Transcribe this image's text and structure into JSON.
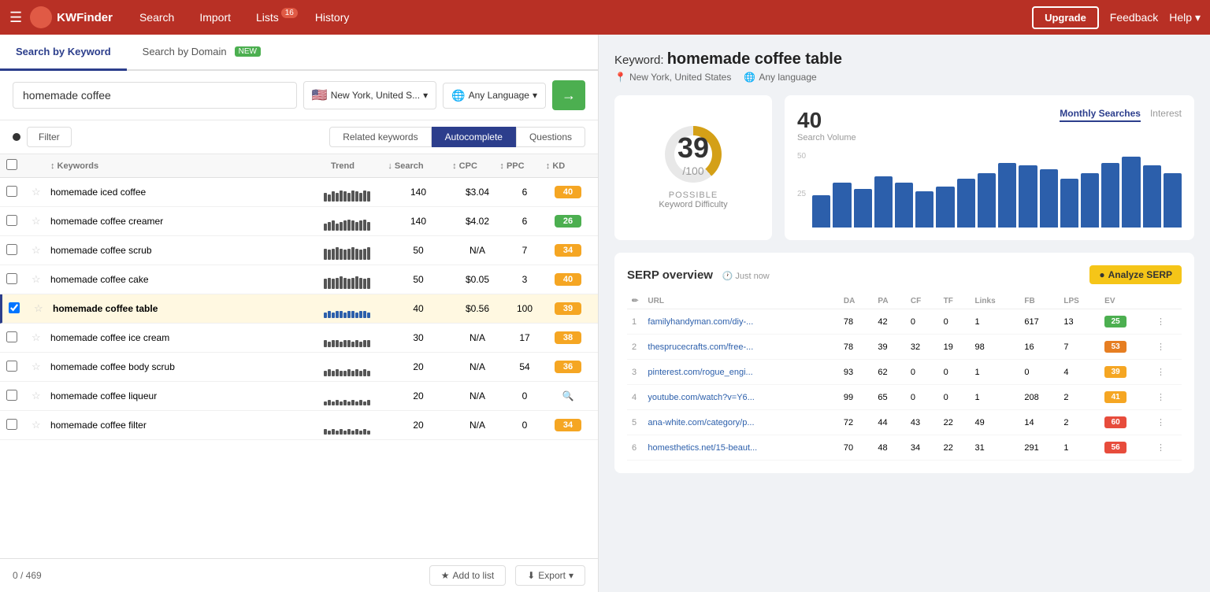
{
  "app": {
    "name": "KWFinder",
    "logo_color": "#b83025"
  },
  "nav": {
    "menu_icon": "☰",
    "links": [
      {
        "id": "search",
        "label": "Search",
        "active": false
      },
      {
        "id": "import",
        "label": "Import",
        "active": false
      },
      {
        "id": "lists",
        "label": "Lists",
        "active": false,
        "badge": "16"
      },
      {
        "id": "history",
        "label": "History",
        "active": false
      }
    ],
    "upgrade_label": "Upgrade",
    "feedback_label": "Feedback",
    "help_label": "Help ▾"
  },
  "left": {
    "tabs": [
      {
        "id": "by-keyword",
        "label": "Search by Keyword",
        "active": true
      },
      {
        "id": "by-domain",
        "label": "Search by Domain",
        "badge": "NEW",
        "active": false
      }
    ],
    "search_input": {
      "value": "homemade coffee",
      "placeholder": "Enter keyword"
    },
    "location": {
      "flag": "🇺🇸",
      "text": "New York, United S..."
    },
    "language": {
      "text": "Any Language"
    },
    "filter_label": "Filter",
    "keyword_type_tabs": [
      {
        "id": "related",
        "label": "Related keywords",
        "active": false
      },
      {
        "id": "autocomplete",
        "label": "Autocomplete",
        "active": true
      },
      {
        "id": "questions",
        "label": "Questions",
        "active": false
      }
    ],
    "table": {
      "columns": [
        "Keywords",
        "Trend",
        "Search",
        "CPC",
        "PPC",
        "KD"
      ],
      "rows": [
        {
          "keyword": "homemade iced coffee",
          "search": 140,
          "cpc": "$3.04",
          "ppc": 6,
          "kd": 40,
          "kd_color": "#f5a623",
          "selected": false,
          "highlighted": false,
          "trend_heights": [
            6,
            5,
            7,
            6,
            8,
            7,
            6,
            8,
            7,
            6,
            8,
            7
          ]
        },
        {
          "keyword": "homemade coffee creamer",
          "search": 140,
          "cpc": "$4.02",
          "ppc": 6,
          "kd": 26,
          "kd_color": "#4CAF50",
          "selected": false,
          "highlighted": false,
          "trend_heights": [
            5,
            6,
            7,
            5,
            6,
            7,
            8,
            7,
            6,
            7,
            8,
            6
          ]
        },
        {
          "keyword": "homemade coffee scrub",
          "search": 50,
          "cpc": "N/A",
          "ppc": 7,
          "kd": 34,
          "kd_color": "#f5a623",
          "selected": false,
          "highlighted": false,
          "trend_heights": [
            8,
            7,
            8,
            9,
            8,
            7,
            8,
            9,
            8,
            7,
            8,
            9
          ]
        },
        {
          "keyword": "homemade coffee cake",
          "search": 50,
          "cpc": "$0.05",
          "ppc": 3,
          "kd": 40,
          "kd_color": "#f5a623",
          "selected": false,
          "highlighted": false,
          "trend_heights": [
            7,
            8,
            7,
            8,
            9,
            8,
            7,
            8,
            9,
            8,
            7,
            8
          ]
        },
        {
          "keyword": "homemade coffee table",
          "search": 40,
          "cpc": "$0.56",
          "ppc": 100,
          "kd": 39,
          "kd_color": "#f5a623",
          "selected": true,
          "highlighted": true,
          "trend_heights": [
            4,
            5,
            4,
            5,
            5,
            4,
            5,
            5,
            4,
            5,
            5,
            4
          ]
        },
        {
          "keyword": "homemade coffee ice cream",
          "search": 30,
          "cpc": "N/A",
          "ppc": 17,
          "kd": 38,
          "kd_color": "#f5a623",
          "selected": false,
          "highlighted": false,
          "trend_heights": [
            5,
            4,
            5,
            5,
            4,
            5,
            5,
            4,
            5,
            4,
            5,
            5
          ]
        },
        {
          "keyword": "homemade coffee body scrub",
          "search": 20,
          "cpc": "N/A",
          "ppc": 54,
          "kd": 36,
          "kd_color": "#f5a623",
          "selected": false,
          "highlighted": false,
          "trend_heights": [
            4,
            5,
            4,
            5,
            4,
            4,
            5,
            4,
            5,
            4,
            5,
            4
          ]
        },
        {
          "keyword": "homemade coffee liqueur",
          "search": 20,
          "cpc": "N/A",
          "ppc": 0,
          "kd": null,
          "kd_color": "#999",
          "selected": false,
          "highlighted": false,
          "trend_heights": [
            3,
            4,
            3,
            4,
            3,
            4,
            3,
            4,
            3,
            4,
            3,
            4
          ]
        },
        {
          "keyword": "homemade coffee filter",
          "search": 20,
          "cpc": "N/A",
          "ppc": 0,
          "kd": 34,
          "kd_color": "#f5a623",
          "selected": false,
          "highlighted": false,
          "trend_heights": [
            4,
            3,
            4,
            3,
            4,
            3,
            4,
            3,
            4,
            3,
            4,
            3
          ]
        }
      ]
    },
    "footer": {
      "count": "0 / 469",
      "add_to_list": "Add to list",
      "export": "Export"
    }
  },
  "right": {
    "keyword_label": "Keyword:",
    "keyword_name": "homemade coffee table",
    "location": "New York, United States",
    "language": "Any language",
    "kd": {
      "value": 39,
      "total": 100,
      "label": "POSSIBLE",
      "sublabel": "Keyword Difficulty"
    },
    "volume": {
      "value": 40,
      "label": "Search Volume",
      "tabs": [
        {
          "id": "monthly",
          "label": "Monthly Searches",
          "active": true
        },
        {
          "id": "interest",
          "label": "Interest",
          "active": false
        }
      ],
      "chart_bars": [
        25,
        35,
        30,
        40,
        35,
        28,
        32,
        38,
        42,
        50,
        48,
        45,
        38,
        42,
        50,
        55,
        48,
        42
      ]
    },
    "serp": {
      "title": "SERP overview",
      "meta": "Just now",
      "analyze_btn": "Analyze SERP",
      "columns": [
        "#",
        "URL",
        "DA",
        "PA",
        "CF",
        "TF",
        "Links",
        "FB",
        "LPS",
        "EV"
      ],
      "rows": [
        {
          "rank": 1,
          "url": "familyhandyman.com/diy-...",
          "da": 78,
          "pa": 42,
          "cf": 0,
          "tf": 0,
          "links": 1,
          "fb": 617,
          "lps": 13,
          "ev": 25,
          "ev_color": "#4CAF50"
        },
        {
          "rank": 2,
          "url": "thesprucecrafts.com/free-...",
          "da": 78,
          "pa": 39,
          "cf": 32,
          "tf": 19,
          "links": 98,
          "fb": 16,
          "lps": 7,
          "ev": 53,
          "ev_color": "#e67e22"
        },
        {
          "rank": 3,
          "url": "pinterest.com/rogue_engi...",
          "da": 93,
          "pa": 62,
          "cf": 0,
          "tf": 0,
          "links": 1,
          "fb": 0,
          "lps": 4,
          "ev": 39,
          "ev_color": "#f5a623"
        },
        {
          "rank": 4,
          "url": "youtube.com/watch?v=Y6...",
          "da": 99,
          "pa": 65,
          "cf": 0,
          "tf": 0,
          "links": 1,
          "fb": 208,
          "lps": 2,
          "ev": 41,
          "ev_color": "#f5a623"
        },
        {
          "rank": 5,
          "url": "ana-white.com/category/p...",
          "da": 72,
          "pa": 44,
          "cf": 43,
          "tf": 22,
          "links": 49,
          "fb": 14,
          "lps": 2,
          "ev": 60,
          "ev_color": "#e74c3c"
        },
        {
          "rank": 6,
          "url": "homesthetics.net/15-beaut...",
          "da": 70,
          "pa": 48,
          "cf": 34,
          "tf": 22,
          "links": 31,
          "fb": 291,
          "lps": 1,
          "ev": 56,
          "ev_color": "#e74c3c"
        }
      ]
    }
  }
}
